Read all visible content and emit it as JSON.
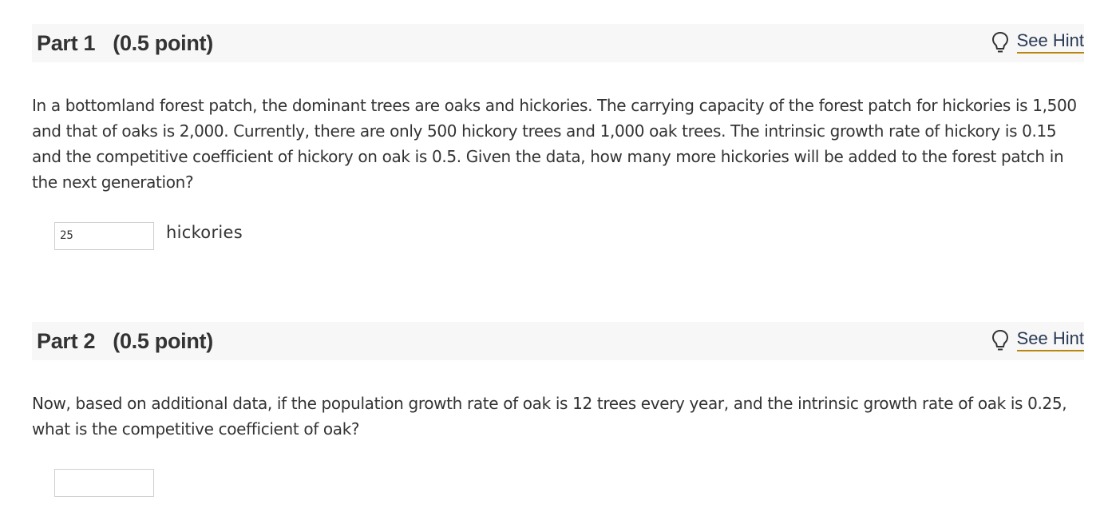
{
  "parts": [
    {
      "title": "Part 1",
      "points": "(0.5 point)",
      "hint_label": "See Hint",
      "question": "In a bottomland forest patch, the dominant trees are oaks and hickories. The carrying capacity of the forest patch for hickories is 1,500 and that of oaks is 2,000. Currently, there are only 500 hickory trees and 1,000 oak trees. The intrinsic growth rate of hickory is 0.15 and the competitive coefficient of hickory on oak is 0.5. Given the data, how many more hickories will be added to the forest patch in the next generation?",
      "answer_value": "25",
      "unit": "hickories"
    },
    {
      "title": "Part 2",
      "points": "(0.5 point)",
      "hint_label": "See Hint",
      "question": "Now, based on additional data, if the population growth rate of oak is 12 trees every year, and the intrinsic growth rate of oak is 0.25, what is the competitive coefficient of oak?",
      "answer_value": ""
    }
  ],
  "icons": {
    "hint": "lightbulb-icon"
  },
  "colors": {
    "hint_underline": "#b8860b",
    "header_bg": "#f7f7f7"
  }
}
